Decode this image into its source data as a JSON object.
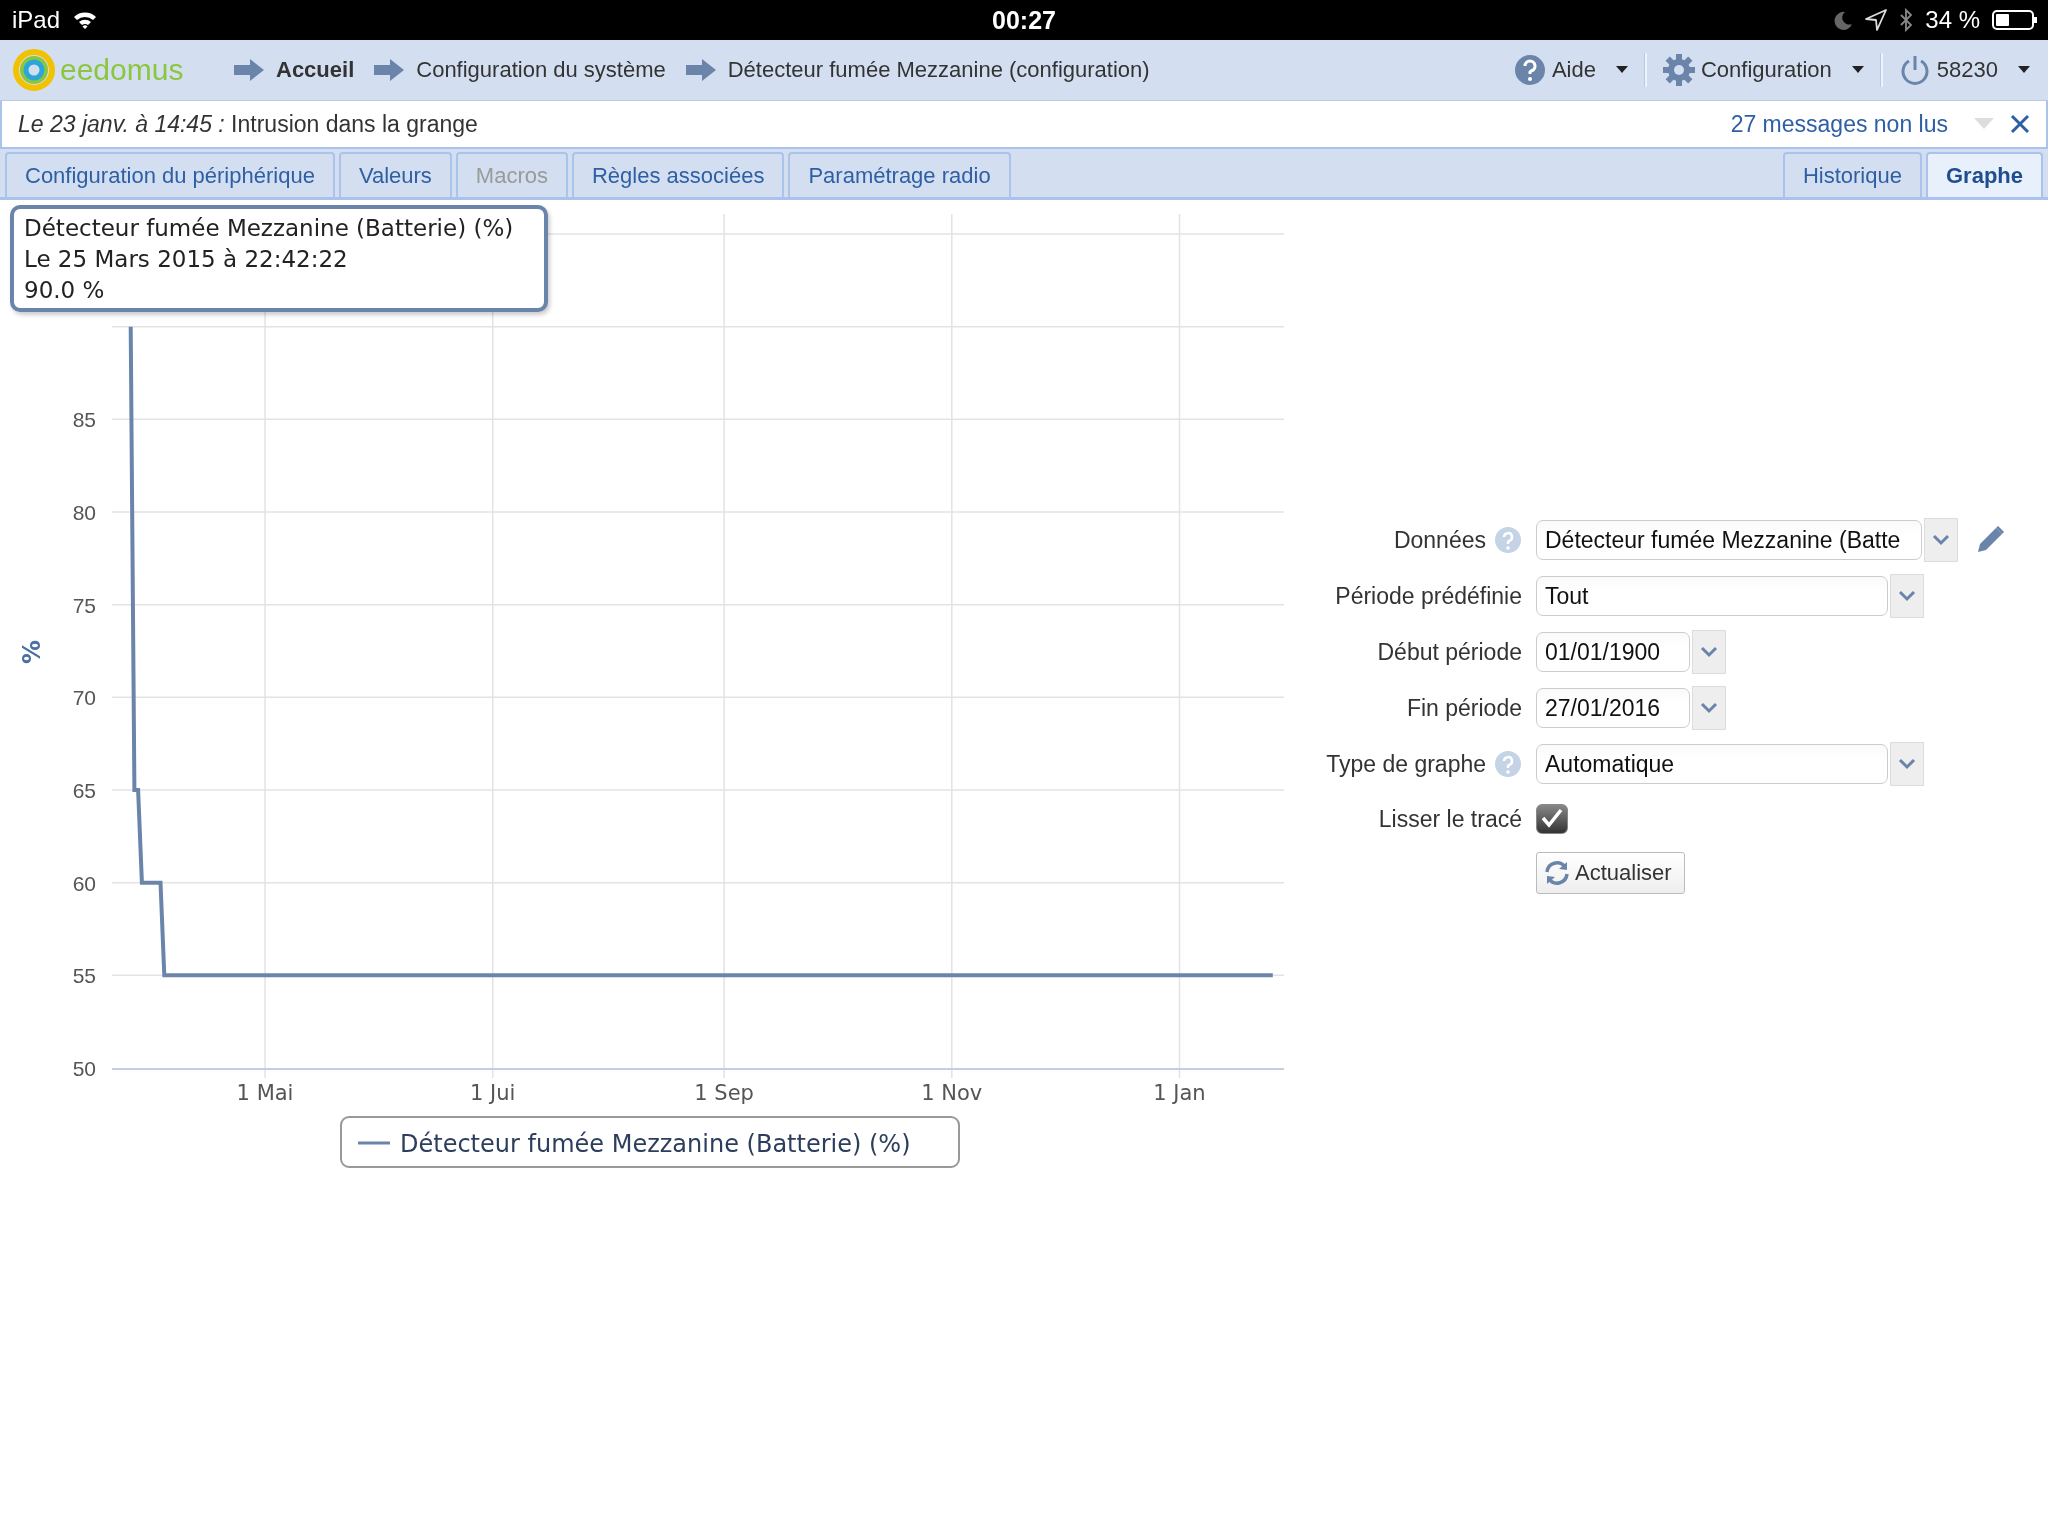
{
  "status_bar": {
    "device": "iPad",
    "time": "00:27",
    "battery": "34 %"
  },
  "header": {
    "logo": "eedomus",
    "breadcrumbs": [
      {
        "label": "Accueil",
        "bold": true
      },
      {
        "label": "Configuration du système",
        "bold": false
      },
      {
        "label": "Détecteur fumée Mezzanine (configuration)",
        "bold": false
      }
    ],
    "menus": [
      {
        "label": "Aide",
        "kind": "help"
      },
      {
        "label": "Configuration",
        "kind": "gear"
      },
      {
        "label": "58230",
        "kind": "power"
      }
    ]
  },
  "notification": {
    "message": "*Le 23 janv. à 14:45 :* Intrusion dans la grange",
    "unread": "27 messages non lus"
  },
  "tabs": [
    {
      "label": "Configuration du périphérique",
      "selected": false,
      "disabled": false
    },
    {
      "label": "Valeurs",
      "selected": false,
      "disabled": false
    },
    {
      "label": "Macros",
      "selected": false,
      "disabled": true
    },
    {
      "label": "Règles associées",
      "selected": false,
      "disabled": false
    },
    {
      "label": "Paramétrage radio",
      "selected": false,
      "disabled": false
    }
  ],
  "view_tabs": [
    {
      "label": "Historique",
      "selected": false
    },
    {
      "label": "Graphe",
      "selected": true
    }
  ],
  "chart": {
    "tooltip": {
      "title": "Détecteur fumée Mezzanine (Batterie) (%)",
      "date": "Le 25 Mars 2015 à 22:42:22",
      "value": "90.0 %"
    },
    "chart_data": {
      "type": "line",
      "ylabel": "%",
      "categories": [
        null,
        null,
        null,
        null,
        null,
        null,
        null,
        null,
        null,
        null,
        null,
        null,
        null,
        null,
        null,
        null,
        null,
        null,
        null,
        null,
        null,
        null,
        null,
        null,
        null,
        null,
        null,
        null,
        null,
        null,
        null,
        null,
        null,
        null,
        null,
        null,
        null,
        null,
        null,
        null,
        null,
        "1 Mai",
        null,
        null,
        null,
        null,
        null,
        null,
        null,
        null,
        null,
        null,
        null,
        null,
        null,
        null,
        null,
        null,
        null,
        null,
        null,
        null,
        null,
        null,
        null,
        null,
        null,
        null,
        null,
        null,
        null,
        null,
        null,
        null,
        null,
        null,
        null,
        null,
        null,
        null,
        null,
        null,
        null,
        null,
        null,
        null,
        null,
        null,
        null,
        null,
        null,
        null,
        null,
        null,
        null,
        null,
        null,
        null,
        null,
        null,
        null,
        null,
        "1 Jui",
        null,
        null,
        null,
        null,
        null,
        null,
        null,
        null,
        null,
        null,
        null,
        null,
        null,
        null,
        null,
        null,
        null,
        null,
        null,
        null,
        null,
        null,
        null,
        null,
        null,
        null,
        null,
        null,
        null,
        null,
        null,
        null,
        null,
        null,
        null,
        null,
        null,
        null,
        null,
        null,
        null,
        null,
        null,
        null,
        null,
        null,
        null,
        null,
        null,
        null,
        null,
        null,
        null,
        null,
        null,
        null,
        null,
        null,
        null,
        null,
        null,
        "1 Sep",
        null,
        null,
        null,
        null,
        null,
        null,
        null,
        null,
        null,
        null,
        null,
        null,
        null,
        null,
        null,
        null,
        null,
        null,
        null,
        null,
        null,
        null,
        null,
        null,
        null,
        null,
        null,
        null,
        null,
        null,
        null,
        null,
        null,
        null,
        null,
        null,
        null,
        null,
        null,
        null,
        null,
        null,
        null,
        null,
        null,
        null,
        null,
        null,
        null,
        null,
        null,
        null,
        null,
        null,
        null,
        null,
        null,
        null,
        null,
        null,
        "1 Nov",
        null,
        null,
        null,
        null,
        null,
        null,
        null,
        null,
        null,
        null,
        null,
        null,
        null,
        null,
        null,
        null,
        null,
        null,
        null,
        null,
        null,
        null,
        null,
        null,
        null,
        null,
        null,
        null,
        null,
        null,
        null,
        null,
        null,
        null,
        null,
        null,
        null,
        null,
        null,
        null,
        null,
        null,
        null,
        null,
        null,
        null,
        null,
        null,
        null,
        null,
        null,
        null,
        null,
        null,
        null,
        null,
        null,
        null,
        null,
        null,
        "1 Jan",
        null,
        null,
        null,
        null,
        null,
        null,
        null,
        null,
        null,
        null,
        null,
        null,
        null,
        null,
        null,
        null,
        null,
        null,
        null,
        null,
        null,
        null,
        null,
        null,
        null,
        null,
        null,
        null
      ],
      "series": [
        {
          "name": "Détecteur fumée Mezzanine (Batterie) (%)",
          "color": "#6b84aa",
          "values": [
            null,
            null,
            null,
            null,
            null,
            90,
            65,
            65,
            60,
            60,
            60,
            60,
            60,
            60,
            55,
            55,
            55,
            55,
            55,
            55,
            55,
            55,
            55,
            55,
            55,
            55,
            55,
            55,
            55,
            55,
            55,
            55,
            55,
            55,
            55,
            55,
            55,
            55,
            55,
            55,
            55,
            55,
            55,
            55,
            55,
            55,
            55,
            55,
            55,
            55,
            55,
            55,
            55,
            55,
            55,
            55,
            55,
            55,
            55,
            55,
            55,
            55,
            55,
            55,
            55,
            55,
            55,
            55,
            55,
            55,
            55,
            55,
            55,
            55,
            55,
            55,
            55,
            55,
            55,
            55,
            55,
            55,
            55,
            55,
            55,
            55,
            55,
            55,
            55,
            55,
            55,
            55,
            55,
            55,
            55,
            55,
            55,
            55,
            55,
            55,
            55,
            55,
            55,
            55,
            55,
            55,
            55,
            55,
            55,
            55,
            55,
            55,
            55,
            55,
            55,
            55,
            55,
            55,
            55,
            55,
            55,
            55,
            55,
            55,
            55,
            55,
            55,
            55,
            55,
            55,
            55,
            55,
            55,
            55,
            55,
            55,
            55,
            55,
            55,
            55,
            55,
            55,
            55,
            55,
            55,
            55,
            55,
            55,
            55,
            55,
            55,
            55,
            55,
            55,
            55,
            55,
            55,
            55,
            55,
            55,
            55,
            55,
            55,
            55,
            55,
            55,
            55,
            55,
            55,
            55,
            55,
            55,
            55,
            55,
            55,
            55,
            55,
            55,
            55,
            55,
            55,
            55,
            55,
            55,
            55,
            55,
            55,
            55,
            55,
            55,
            55,
            55,
            55,
            55,
            55,
            55,
            55,
            55,
            55,
            55,
            55,
            55,
            55,
            55,
            55,
            55,
            55,
            55,
            55,
            55,
            55,
            55,
            55,
            55,
            55,
            55,
            55,
            55,
            55,
            55,
            55,
            55,
            55,
            55,
            55,
            55,
            55,
            55,
            55,
            55,
            55,
            55,
            55,
            55,
            55,
            55,
            55,
            55,
            55,
            55,
            55,
            55,
            55,
            55,
            55,
            55,
            55,
            55,
            55,
            55,
            55,
            55,
            55,
            55,
            55,
            55,
            55,
            55,
            55,
            55,
            55,
            55,
            55,
            55,
            55,
            55,
            55,
            55,
            55,
            55,
            55,
            55,
            55,
            55,
            55,
            55,
            55,
            55,
            55,
            55,
            55,
            55,
            55,
            55,
            55,
            55,
            55,
            55,
            55,
            55,
            55,
            55,
            55,
            55,
            55,
            55,
            55,
            55,
            55,
            55,
            55,
            55,
            55,
            55,
            55,
            55,
            55,
            55,
            55,
            55,
            55,
            55,
            null,
            null,
            null
          ]
        }
      ],
      "grid": true,
      "ylim": [
        50,
        95
      ],
      "yticks": [
        50,
        55,
        60,
        65,
        70,
        75,
        80,
        85
      ]
    }
  },
  "form": {
    "fields": [
      {
        "label": "Données",
        "kind": "select",
        "value": "Détecteur fumée Mezzanine (Batte",
        "help": true,
        "editable": true
      },
      {
        "label": "Période prédéfinie",
        "kind": "select",
        "value": "Tout",
        "help": false,
        "editable": false
      },
      {
        "label": "Début période",
        "kind": "date",
        "value": "01/01/1900",
        "help": false,
        "editable": false
      },
      {
        "label": "Fin période",
        "kind": "date",
        "value": "27/01/2016",
        "help": false,
        "editable": false
      },
      {
        "label": "Type de graphe",
        "kind": "select",
        "value": "Automatique",
        "help": true,
        "editable": false
      },
      {
        "label": "Lisser le tracé",
        "kind": "checkbox",
        "checked": true,
        "help": false,
        "editable": false
      }
    ],
    "button": "Actualiser"
  }
}
